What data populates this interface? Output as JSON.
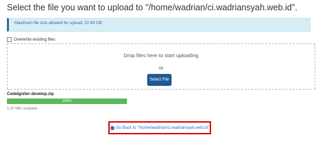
{
  "header": {
    "title": "Select the file you want to upload to \"/home/wadrian/ci.wadriansyah.web.id\"."
  },
  "info": {
    "max_size_text": "Maximum file size allowed for upload: 22.94 GB",
    "color": "#d9edf7"
  },
  "options": {
    "overwrite_label": "Overwrite existing files",
    "overwrite_checked": false
  },
  "dropzone": {
    "drop_text": "Drop files here to start uploading",
    "or_text": "or",
    "select_button_label": "Select File"
  },
  "upload": {
    "file_name": "CodeIgniter-develop.zip",
    "progress_label": "100%",
    "progress_fraction": 1.0,
    "status_text": "1.37 MB complete",
    "progress_color": "#5cb85c"
  },
  "footer": {
    "go_back_icon": "arrow-left-circle-icon",
    "go_back_label": "Go Back to \"/home/wadrian/ci.wadriansyah.web.id\"",
    "highlight_color": "#e00000"
  }
}
